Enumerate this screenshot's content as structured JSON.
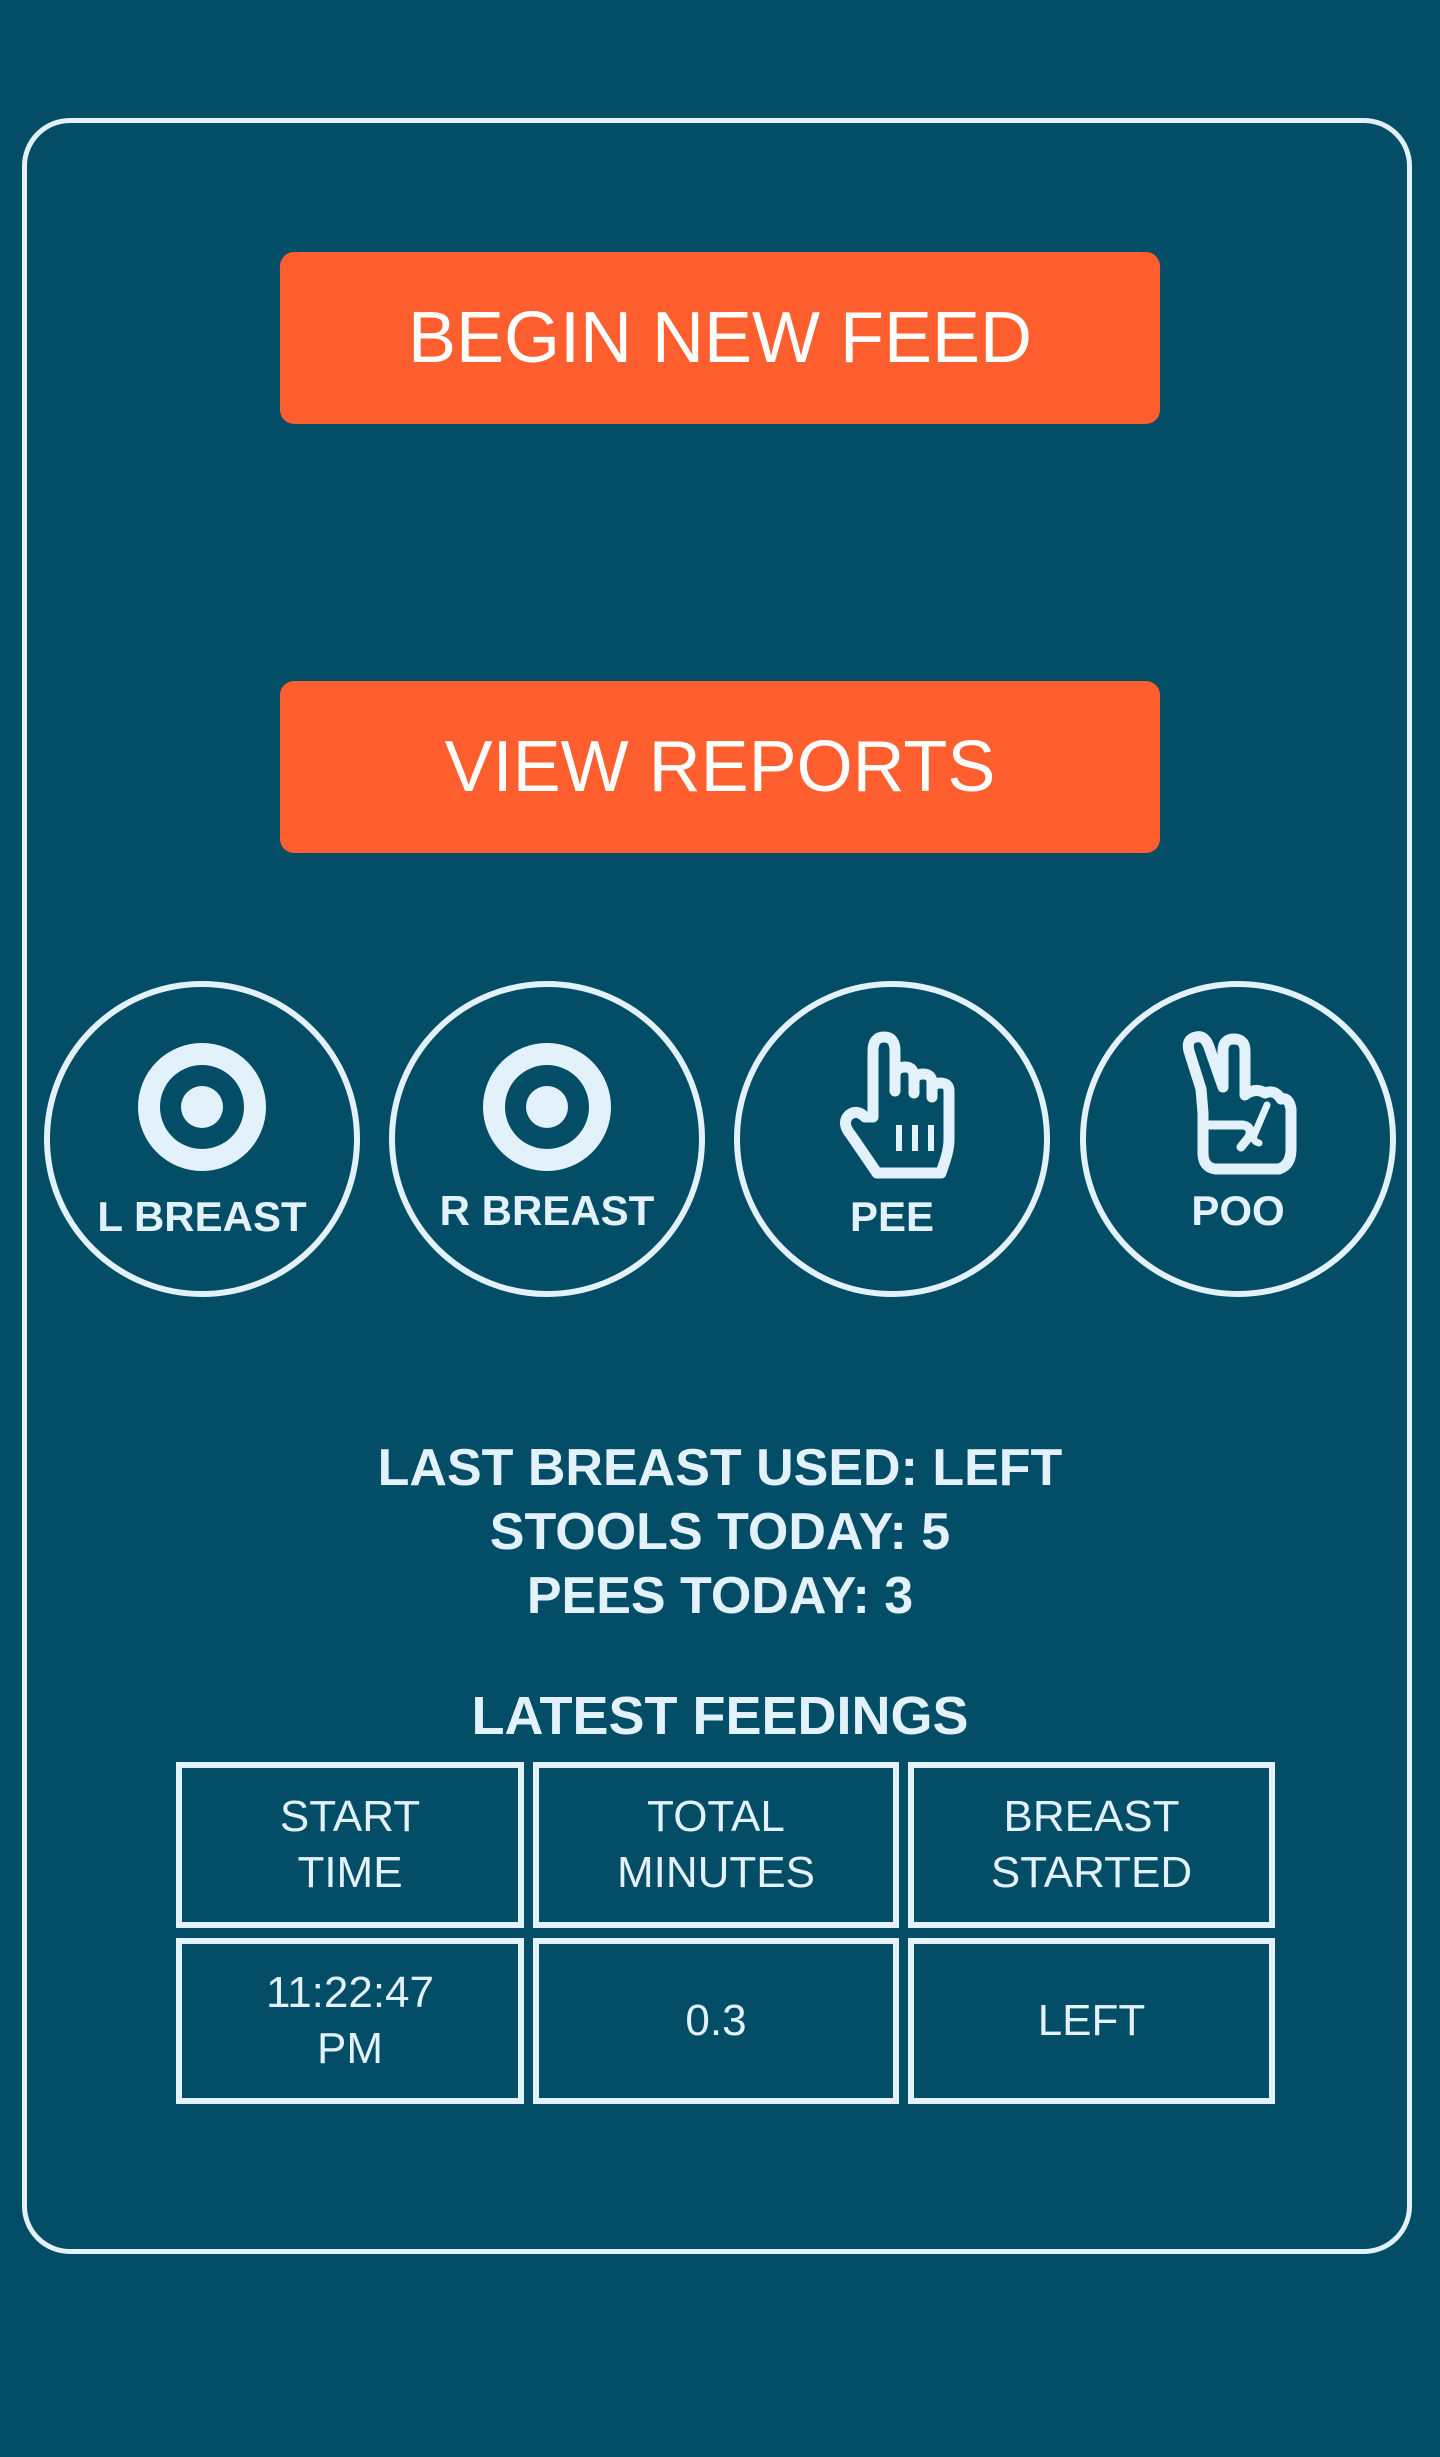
{
  "buttons": {
    "begin_new_feed": "BEGIN NEW FEED",
    "view_reports": "VIEW REPORTS"
  },
  "quick_actions": [
    {
      "label": "L BREAST",
      "icon": "target-icon"
    },
    {
      "label": "R BREAST",
      "icon": "target-icon"
    },
    {
      "label": "PEE",
      "icon": "pointing-hand-icon"
    },
    {
      "label": "POO",
      "icon": "peace-hand-icon"
    }
  ],
  "stats": {
    "last_breast_used": "LAST BREAST USED: LEFT",
    "stools_today": "STOOLS TODAY: 5",
    "pees_today": "PEES TODAY: 3"
  },
  "latest_feedings": {
    "title": "LATEST FEEDINGS",
    "headers": [
      [
        "START",
        "TIME"
      ],
      [
        "TOTAL",
        "MINUTES"
      ],
      [
        "BREAST",
        "STARTED"
      ]
    ],
    "rows": [
      {
        "start_time": [
          "11:22:47",
          "PM"
        ],
        "total_minutes": "0.3",
        "breast_started": "LEFT"
      }
    ]
  },
  "colors": {
    "background": "#034e66",
    "accent": "#ff5f2e",
    "foreground": "#e3f2fa"
  }
}
